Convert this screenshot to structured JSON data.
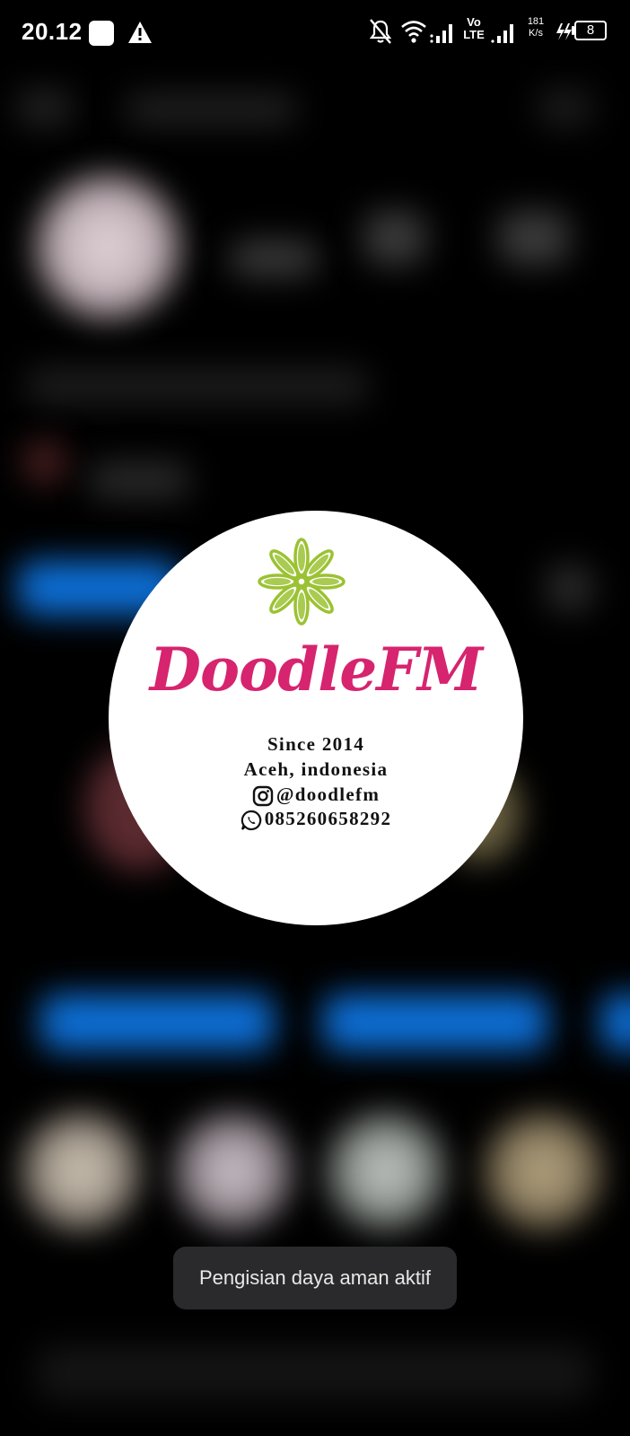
{
  "status_bar": {
    "time": "20.12",
    "network_speed_value": "181",
    "network_speed_unit": "K/s",
    "volte_top": "Vo",
    "volte_bottom": "LTE",
    "battery_level": "8",
    "icons": [
      "notification-square-icon",
      "warning-icon",
      "mute-bell-icon",
      "wifi-icon",
      "signal-icon",
      "volte-icon",
      "signal-icon",
      "fast-charging-icon",
      "battery-icon"
    ]
  },
  "profile_popup": {
    "brand_name": "DoodleFM",
    "since": "Since 2014",
    "location": "Aceh, indonesia",
    "instagram": "@doodlefm",
    "whatsapp": "085260658292",
    "colors": {
      "brand": "#d6246f",
      "flower": "#9bc232"
    }
  },
  "toast": {
    "message": "Pengisian daya aman aktif"
  }
}
